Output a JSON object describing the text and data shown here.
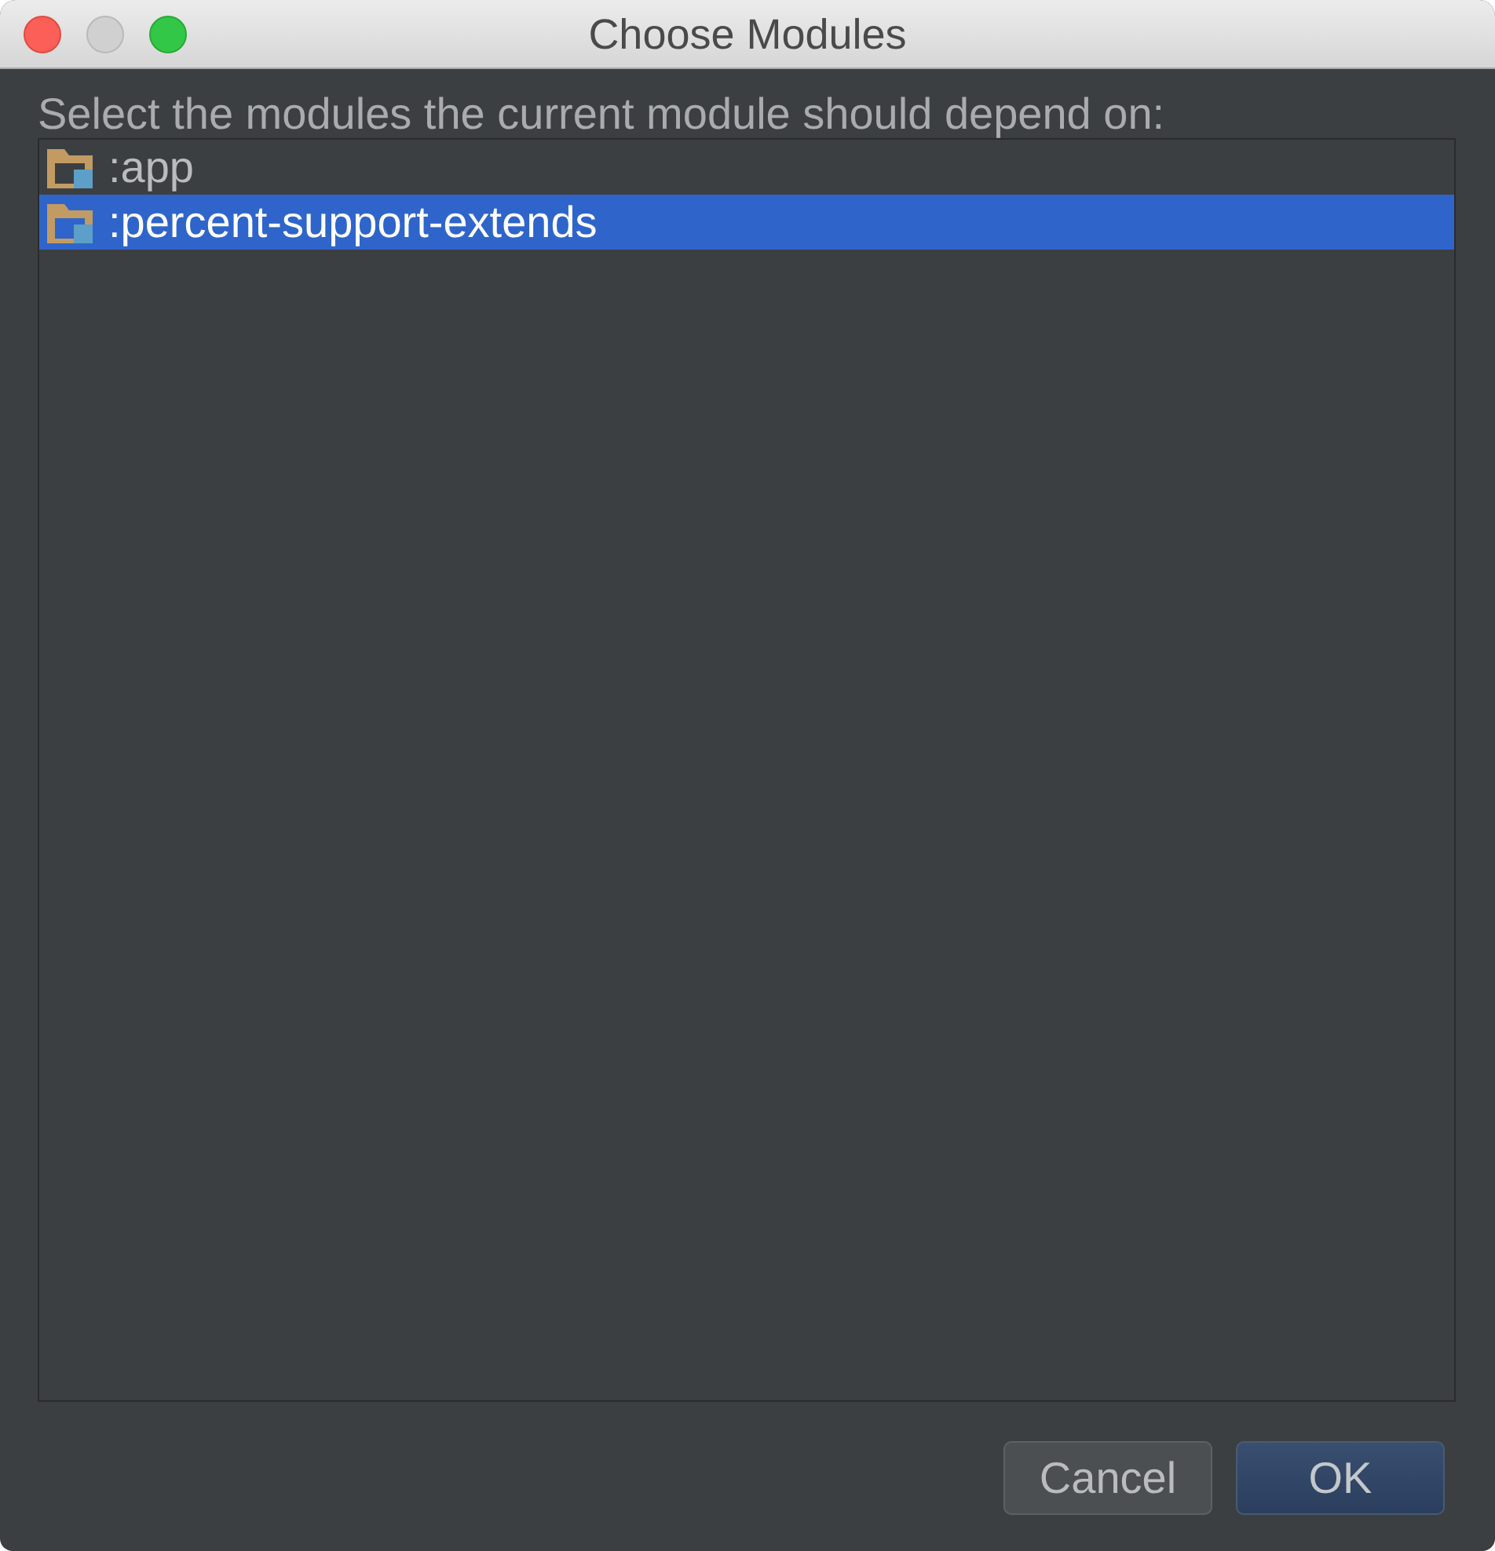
{
  "window": {
    "title": "Choose Modules",
    "controls": [
      {
        "kind": "close",
        "disabled": false
      },
      {
        "kind": "minimize",
        "disabled": true
      },
      {
        "kind": "zoom",
        "disabled": false
      }
    ]
  },
  "prompt": "Select the modules the current module should depend on:",
  "modules": [
    {
      "name": ":app",
      "selected": false
    },
    {
      "name": ":percent-support-extends",
      "selected": true
    }
  ],
  "buttons": [
    {
      "label": "Cancel",
      "kind": "secondary"
    },
    {
      "label": "OK",
      "kind": "default"
    }
  ]
}
